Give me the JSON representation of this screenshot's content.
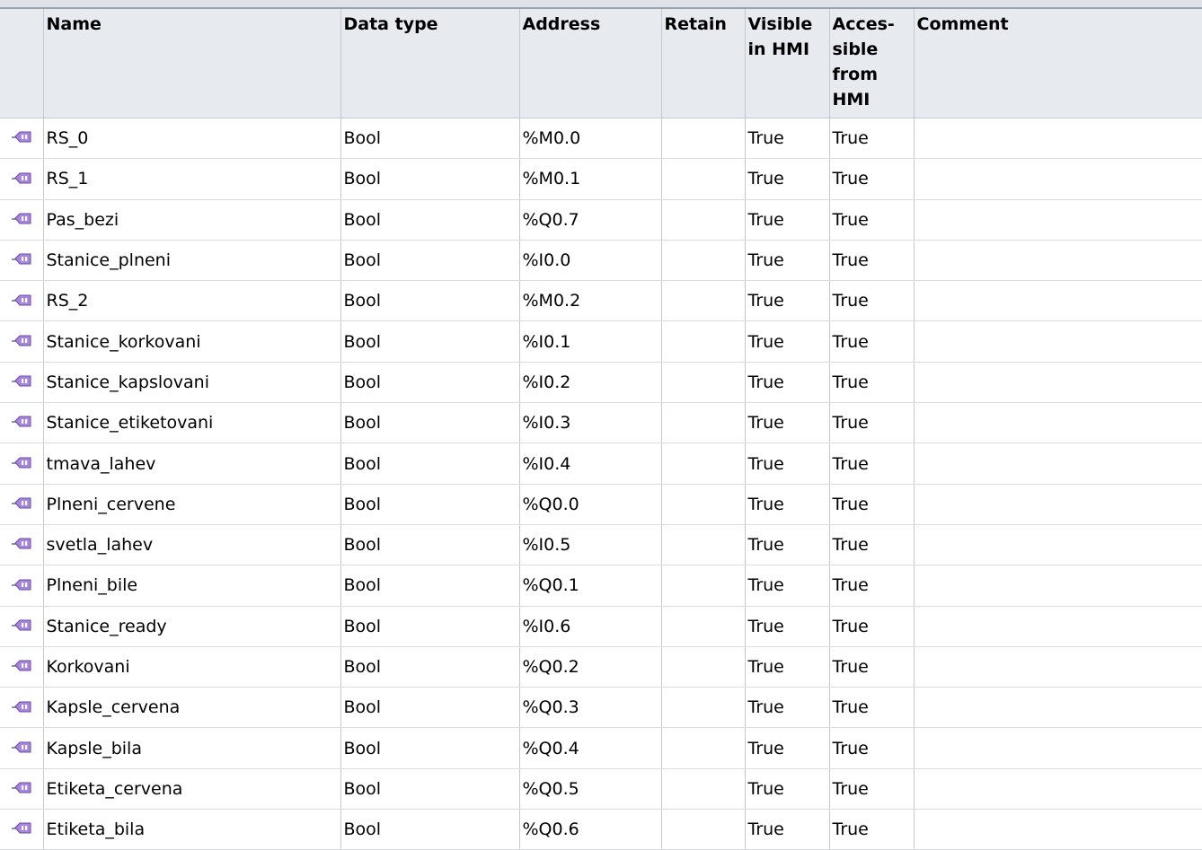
{
  "columns": {
    "name": "Name",
    "data_type": "Data type",
    "address": "Address",
    "retain": "Retain",
    "visible": "Visible in HMI",
    "accessible": "Acces- sible from HMI",
    "comment": "Comment"
  },
  "icon": "plc-tag-icon",
  "colors": {
    "header_bg": "#e7ebf0",
    "grid": "#c5c9cf",
    "icon": "#8a63c8"
  },
  "rows": [
    {
      "name": "RS_0",
      "type": "Bool",
      "address": "%M0.0",
      "retain": "",
      "visible": "True",
      "accessible": "True",
      "comment": ""
    },
    {
      "name": "RS_1",
      "type": "Bool",
      "address": "%M0.1",
      "retain": "",
      "visible": "True",
      "accessible": "True",
      "comment": ""
    },
    {
      "name": "Pas_bezi",
      "type": "Bool",
      "address": "%Q0.7",
      "retain": "",
      "visible": "True",
      "accessible": "True",
      "comment": ""
    },
    {
      "name": "Stanice_plneni",
      "type": "Bool",
      "address": "%I0.0",
      "retain": "",
      "visible": "True",
      "accessible": "True",
      "comment": ""
    },
    {
      "name": "RS_2",
      "type": "Bool",
      "address": "%M0.2",
      "retain": "",
      "visible": "True",
      "accessible": "True",
      "comment": ""
    },
    {
      "name": "Stanice_korkovani",
      "type": "Bool",
      "address": "%I0.1",
      "retain": "",
      "visible": "True",
      "accessible": "True",
      "comment": ""
    },
    {
      "name": "Stanice_kapslovani",
      "type": "Bool",
      "address": "%I0.2",
      "retain": "",
      "visible": "True",
      "accessible": "True",
      "comment": ""
    },
    {
      "name": "Stanice_etiketovani",
      "type": "Bool",
      "address": "%I0.3",
      "retain": "",
      "visible": "True",
      "accessible": "True",
      "comment": ""
    },
    {
      "name": "tmava_lahev",
      "type": "Bool",
      "address": "%I0.4",
      "retain": "",
      "visible": "True",
      "accessible": "True",
      "comment": ""
    },
    {
      "name": "Plneni_cervene",
      "type": "Bool",
      "address": "%Q0.0",
      "retain": "",
      "visible": "True",
      "accessible": "True",
      "comment": ""
    },
    {
      "name": "svetla_lahev",
      "type": "Bool",
      "address": "%I0.5",
      "retain": "",
      "visible": "True",
      "accessible": "True",
      "comment": ""
    },
    {
      "name": "Plneni_bile",
      "type": "Bool",
      "address": "%Q0.1",
      "retain": "",
      "visible": "True",
      "accessible": "True",
      "comment": ""
    },
    {
      "name": "Stanice_ready",
      "type": "Bool",
      "address": "%I0.6",
      "retain": "",
      "visible": "True",
      "accessible": "True",
      "comment": ""
    },
    {
      "name": "Korkovani",
      "type": "Bool",
      "address": "%Q0.2",
      "retain": "",
      "visible": "True",
      "accessible": "True",
      "comment": ""
    },
    {
      "name": "Kapsle_cervena",
      "type": "Bool",
      "address": "%Q0.3",
      "retain": "",
      "visible": "True",
      "accessible": "True",
      "comment": ""
    },
    {
      "name": "Kapsle_bila",
      "type": "Bool",
      "address": "%Q0.4",
      "retain": "",
      "visible": "True",
      "accessible": "True",
      "comment": ""
    },
    {
      "name": "Etiketa_cervena",
      "type": "Bool",
      "address": "%Q0.5",
      "retain": "",
      "visible": "True",
      "accessible": "True",
      "comment": ""
    },
    {
      "name": "Etiketa_bila",
      "type": "Bool",
      "address": "%Q0.6",
      "retain": "",
      "visible": "True",
      "accessible": "True",
      "comment": ""
    }
  ]
}
